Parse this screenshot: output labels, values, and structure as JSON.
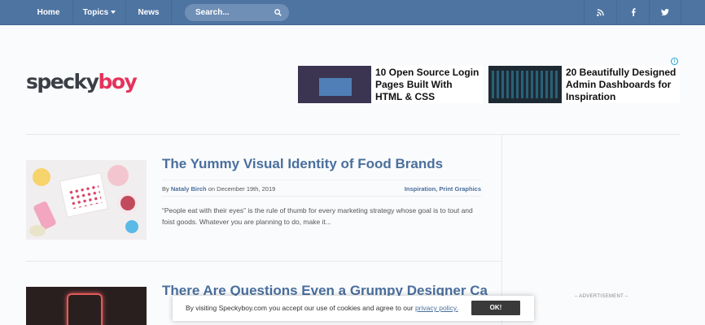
{
  "nav": {
    "home": "Home",
    "topics": "Topics",
    "news": "News",
    "search_placeholder": "Search...",
    "social": [
      "rss-icon",
      "facebook-icon",
      "twitter-icon"
    ]
  },
  "logo": {
    "part1": "specky",
    "part2": "boy"
  },
  "ads": [
    {
      "title": "10 Open Source Login Pages Built With HTML & CSS"
    },
    {
      "title": "20 Beautifully Designed Admin Dashboards for Inspiration"
    }
  ],
  "articles": [
    {
      "title": "The Yummy Visual Identity of Food Brands",
      "by": "By",
      "author": "Nataly Birch",
      "date": "on December 19th, 2019",
      "categories": "Inspiration, Print Graphics",
      "excerpt": "“People eat with their eyes” is the rule of thumb for every marketing strategy whose goal is to tout and foist goods. Whatever you are planning to do, make it..."
    },
    {
      "title": "There Are Questions Even a Grumpy Designer Ca"
    }
  ],
  "sidebar": {
    "advertisement_label": "– ADVERTISEMENT –"
  },
  "cookie": {
    "text": "By visiting Speckyboy.com you accept our use of cookies and agree to our",
    "link": "privacy policy.",
    "button": "OK!"
  },
  "colors": {
    "nav": "#4e74a2",
    "link": "#4a6f9e",
    "brand_accent": "#e5335a"
  }
}
